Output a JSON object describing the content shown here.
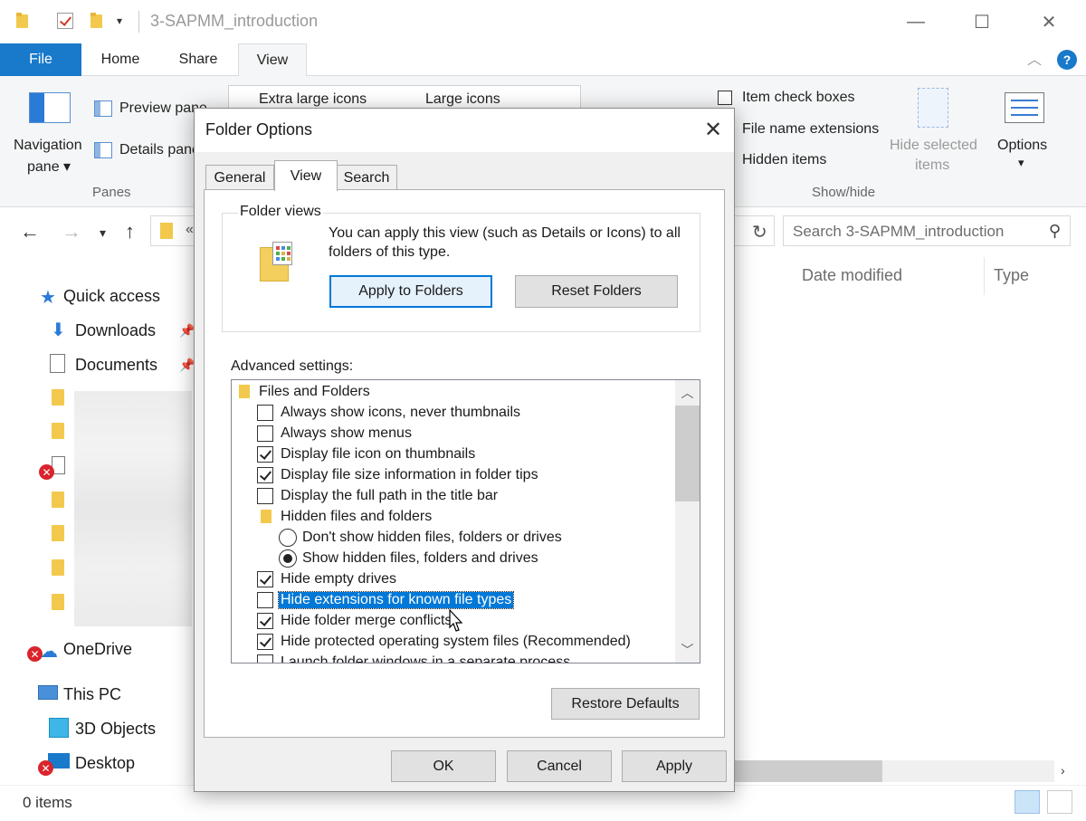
{
  "window": {
    "title": "3-SAPMM_introduction",
    "tabs": [
      "File",
      "Home",
      "Share",
      "View"
    ],
    "help_label": "?"
  },
  "ribbon": {
    "navigation_pane": "Navigation",
    "navigation_pane_line2": "pane ▾",
    "preview_pane": "Preview pane",
    "details_pane": "Details pane",
    "panes_group": "Panes",
    "extra_large_icons": "Extra large icons",
    "large_icons": "Large icons",
    "item_check_boxes": "Item check boxes",
    "file_name_extensions": "File name extensions",
    "hidden_items": "Hidden items",
    "hide_selected_items_line1": "Hide selected",
    "hide_selected_items_line2": "items",
    "options": "Options",
    "options_arrow": "▾",
    "showhide_group": "Show/hide"
  },
  "address": {
    "search_placeholder": "Search 3-SAPMM_introduction",
    "path_fragment": "«"
  },
  "columns": [
    "Date modified",
    "Type"
  ],
  "navtree": {
    "quick_access": "Quick access",
    "downloads": "Downloads",
    "documents": "Documents",
    "onedrive": "OneDrive",
    "this_pc": "This PC",
    "objects_3d": "3D Objects",
    "desktop": "Desktop"
  },
  "status": {
    "items": "0 items"
  },
  "dialog": {
    "title": "Folder Options",
    "tabs": [
      "General",
      "View",
      "Search"
    ],
    "folder_views_legend": "Folder views",
    "folder_views_text": "You can apply this view (such as Details or Icons) to all folders of this type.",
    "apply_to_folders": "Apply to Folders",
    "reset_folders": "Reset Folders",
    "advanced_label": "Advanced settings:",
    "settings": [
      {
        "label": "Files and Folders",
        "kind": "folder"
      },
      {
        "label": "Always show icons, never thumbnails",
        "kind": "checkbox",
        "checked": false
      },
      {
        "label": "Always show menus",
        "kind": "checkbox",
        "checked": false
      },
      {
        "label": "Display file icon on thumbnails",
        "kind": "checkbox",
        "checked": true
      },
      {
        "label": "Display file size information in folder tips",
        "kind": "checkbox",
        "checked": true
      },
      {
        "label": "Display the full path in the title bar",
        "kind": "checkbox",
        "checked": false
      },
      {
        "label": "Hidden files and folders",
        "kind": "folder"
      },
      {
        "label": "Don't show hidden files, folders or drives",
        "kind": "radio",
        "checked": false
      },
      {
        "label": "Show hidden files, folders and drives",
        "kind": "radio",
        "checked": true
      },
      {
        "label": "Hide empty drives",
        "kind": "checkbox",
        "checked": true
      },
      {
        "label": "Hide extensions for known file types",
        "kind": "checkbox",
        "checked": false,
        "selected": true
      },
      {
        "label": "Hide folder merge conflicts",
        "kind": "checkbox",
        "checked": true
      },
      {
        "label": "Hide protected operating system files (Recommended)",
        "kind": "checkbox",
        "checked": true
      },
      {
        "label": "Launch folder windows in a separate process",
        "kind": "checkbox",
        "checked": false
      }
    ],
    "restore_defaults": "Restore Defaults",
    "ok": "OK",
    "cancel": "Cancel",
    "apply": "Apply"
  }
}
